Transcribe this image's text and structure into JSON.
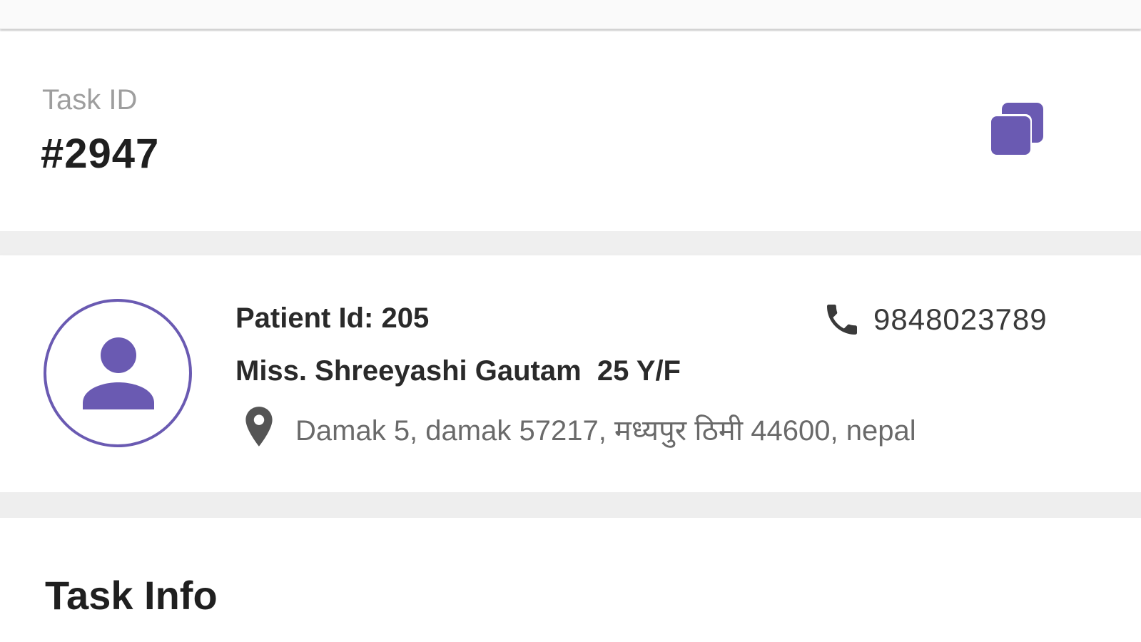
{
  "task": {
    "label": "Task ID",
    "id": "#2947"
  },
  "patient": {
    "id_text": "Patient Id: 205",
    "name_text": "Miss. Shreeyashi Gautam  25 Y/F",
    "phone": "9848023789",
    "address": "Damak 5, damak 57217, मध्यपुर ठिमी 44600, nepal"
  },
  "section": {
    "task_info_title": "Task Info"
  },
  "icons": {
    "copy": "copy-icon",
    "avatar": "person-avatar-icon",
    "phone": "phone-icon",
    "location": "location-pin-icon"
  },
  "colors": {
    "accent": "#6a5ab2",
    "text_primary": "#1f1f1f",
    "text_secondary": "#6a6a6a",
    "label_gray": "#9e9e9e",
    "background": "#f5f5f6"
  }
}
